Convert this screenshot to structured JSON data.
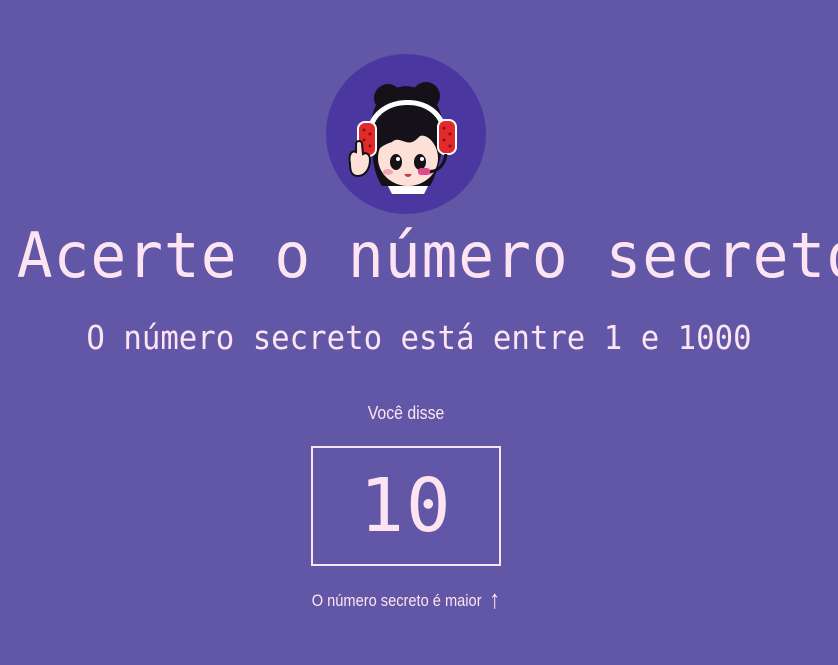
{
  "header": {
    "title": "Acerte o número secreto",
    "subtitle": "O número secreto está entre 1 e 1000"
  },
  "guess": {
    "label": "Você disse",
    "value": "10"
  },
  "hint": {
    "text": "O número secreto é maior",
    "arrow": "↑"
  },
  "icons": {
    "avatar": "headset-girl-avatar-icon",
    "hint_arrow": "arrow-up-icon"
  },
  "colors": {
    "background": "#6157a6",
    "avatar_circle": "#4a38a0",
    "text": "#fde4f2",
    "headset": "#e22a2a"
  }
}
